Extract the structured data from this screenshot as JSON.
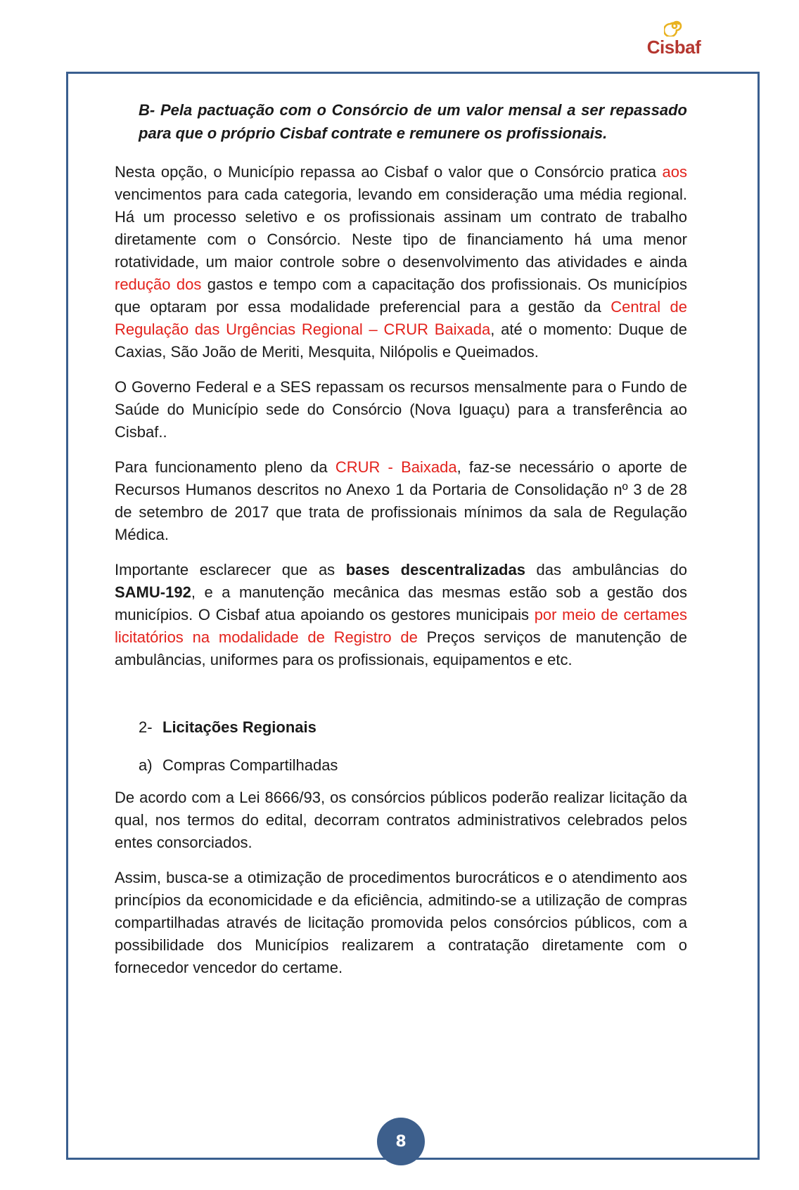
{
  "logo": {
    "text": "Cisbaf"
  },
  "heading": "B- Pela pactuação com o Consórcio de um valor mensal a ser repassado para que o próprio Cisbaf contrate e remunere os profissionais.",
  "p1": {
    "t1": "Nesta opção, o Município repassa ao Cisbaf o valor que o Consórcio pratica ",
    "r1": "aos",
    "t2": " vencimentos para cada categoria, levando em consideração uma média regional. Há um processo seletivo e os profissionais assinam um contrato de trabalho diretamente com o Consórcio. Neste tipo de financiamento há uma menor rotatividade, um maior controle sobre o desenvolvimento das atividades e ainda ",
    "r2": "redução dos",
    "t3": " gastos e tempo com a capacitação dos profissionais. Os municípios que optaram por essa modalidade preferencial para a gestão da ",
    "r3": "Central de Regulação das Urgências Regional – CRUR Baixada",
    "t4": ", até o momento: Duque de Caxias, São João de Meriti, Mesquita, Nilópolis e Queimados."
  },
  "p2": "O Governo Federal e a SES repassam os recursos mensalmente para o Fundo de Saúde do Município sede do Consórcio (Nova Iguaçu) para a transferência ao Cisbaf..",
  "p3": {
    "t1": "Para funcionamento pleno da ",
    "r1": "CRUR - Baixada",
    "t2": ", faz-se necessário o aporte de Recursos Humanos descritos no Anexo 1 da Portaria de Consolidação nº 3 de 28 de setembro de 2017 que trata de profissionais mínimos da sala de Regulação Médica."
  },
  "p4": {
    "t1": "Importante esclarecer que as ",
    "b1": "bases descentralizadas",
    "t2": " das ambulâncias do ",
    "b2": "SAMU-192",
    "t3": ", e a manutenção mecânica das mesmas estão sob a gestão dos municípios. O Cisbaf atua apoiando os gestores municipais ",
    "r1": "por meio de certames licitatórios na modalidade de Registro de",
    "t4": " Preços serviços de manutenção de ambulâncias, uniformes para os profissionais, equipamentos e etc."
  },
  "section": {
    "number": "2-",
    "title": "Licitações Regionais"
  },
  "item_a": {
    "label": "a)",
    "text": "Compras Compartilhadas"
  },
  "p5": "De acordo com a Lei 8666/93, os consórcios públicos poderão realizar licitação da qual, nos termos do edital, decorram contratos administrativos celebrados pelos entes consorciados.",
  "p6": "Assim, busca-se a otimização de procedimentos burocráticos e o atendimento aos princípios da economicidade e da eficiência, admitindo-se a utilização de compras compartilhadas através de licitação promovida pelos consórcios públicos, com a possibilidade dos Municípios realizarem a contratação diretamente com o fornecedor vencedor do certame.",
  "page_number": "8",
  "colors": {
    "frame": "#3a5f8f",
    "highlight_red": "#e3221c",
    "logo_red": "#b5362f",
    "logo_yellow": "#e9b21f",
    "page_badge": "#3d5f8c"
  }
}
